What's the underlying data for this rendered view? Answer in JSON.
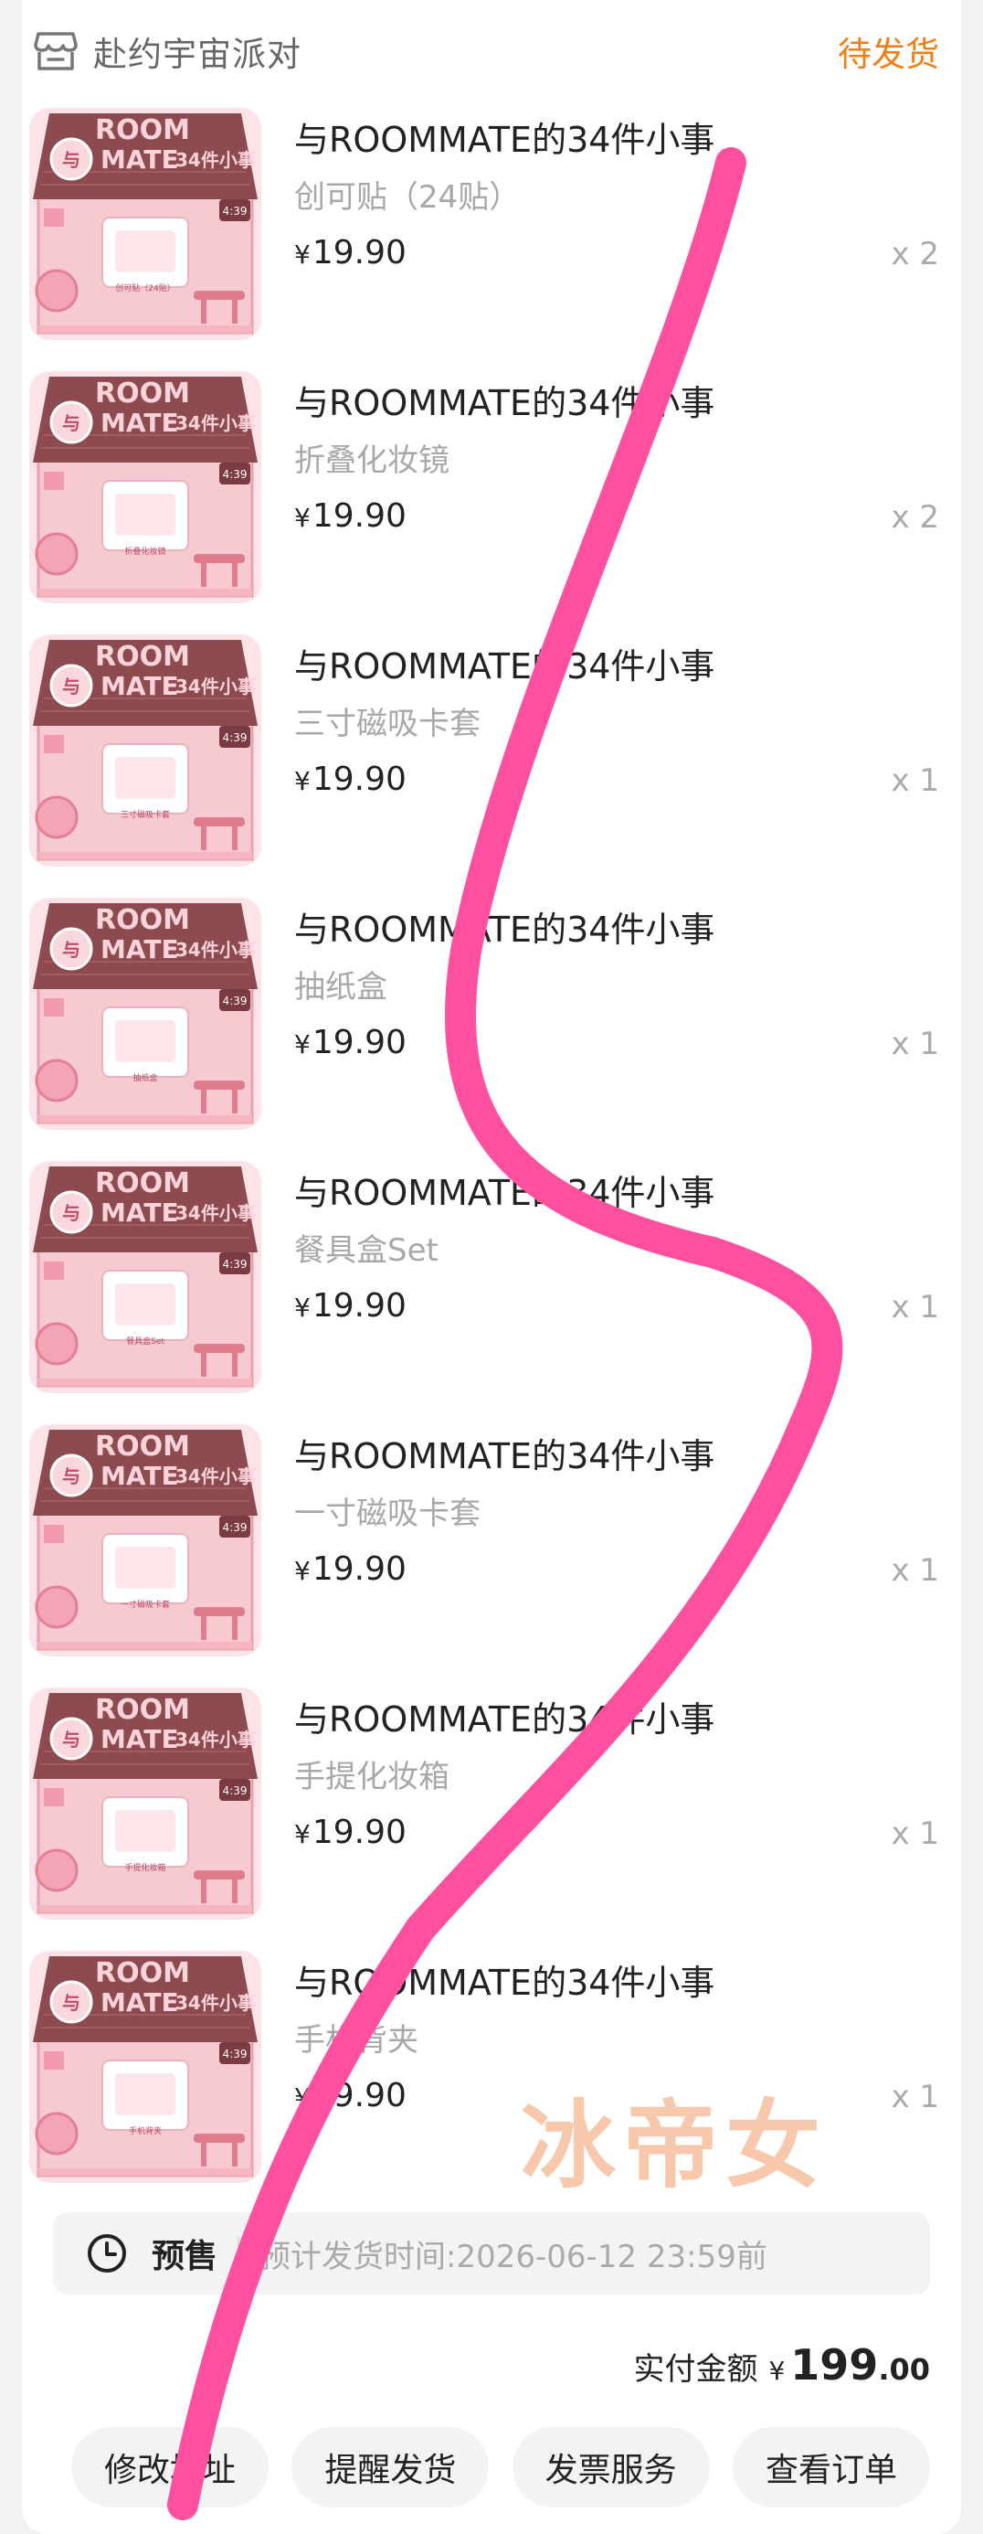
{
  "shop": {
    "icon": "shop-icon",
    "name": "赴约宇宙派对",
    "status": "待发货"
  },
  "items": [
    {
      "title": "与ROOMMATE的34件小事",
      "spec": "创可贴（24贴）",
      "currency": "¥",
      "price": "19.90",
      "qty": "x 2",
      "thumb_caption": "创可贴（24贴）"
    },
    {
      "title": "与ROOMMATE的34件小事",
      "spec": "折叠化妆镜",
      "currency": "¥",
      "price": "19.90",
      "qty": "x 2",
      "thumb_caption": "折叠化妆镜"
    },
    {
      "title": "与ROOMMATE的34件小事",
      "spec": "三寸磁吸卡套",
      "currency": "¥",
      "price": "19.90",
      "qty": "x 1",
      "thumb_caption": "三寸磁吸卡套"
    },
    {
      "title": "与ROOMMATE的34件小事",
      "spec": "抽纸盒",
      "currency": "¥",
      "price": "19.90",
      "qty": "x 1",
      "thumb_caption": "抽纸盒"
    },
    {
      "title": "与ROOMMATE的34件小事",
      "spec": "餐具盒Set",
      "currency": "¥",
      "price": "19.90",
      "qty": "x 1",
      "thumb_caption": "餐具盒Set"
    },
    {
      "title": "与ROOMMATE的34件小事",
      "spec": "一寸磁吸卡套",
      "currency": "¥",
      "price": "19.90",
      "qty": "x 1",
      "thumb_caption": "一寸磁吸卡套"
    },
    {
      "title": "与ROOMMATE的34件小事",
      "spec": "手提化妆箱",
      "currency": "¥",
      "price": "19.90",
      "qty": "x 1",
      "thumb_caption": "手提化妆箱"
    },
    {
      "title": "与ROOMMATE的34件小事",
      "spec": "手机背夹",
      "currency": "¥",
      "price": "19.90",
      "qty": "x 1",
      "thumb_caption": "手机背夹"
    }
  ],
  "thumb_art": {
    "line1": "ROOM",
    "line2": "MATE",
    "badge": "与",
    "count": "34件小事",
    "clock": "4:39",
    "roof_color": "#8d4a4f",
    "wall_color": "#f7c9d1"
  },
  "presale": {
    "icon": "clock-icon",
    "tag": "预售",
    "text": "预计发货时间:2026-06-12 23:59前"
  },
  "total": {
    "label": "实付金额",
    "currency": "¥",
    "integer": "199",
    "decimal": ".00"
  },
  "actions": [
    "修改地址",
    "提醒发货",
    "发票服务",
    "查看订单"
  ],
  "watermark": "冰帝女",
  "colors": {
    "accent": "#f07e16",
    "scribble": "#ff4f9f"
  }
}
